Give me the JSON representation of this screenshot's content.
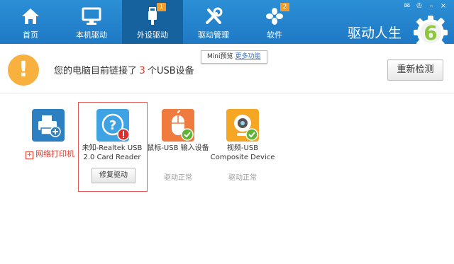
{
  "window": {
    "buttons": [
      "✉",
      "♔",
      "–",
      "×"
    ]
  },
  "tabs": [
    {
      "label": "首页",
      "icon": "home-icon"
    },
    {
      "label": "本机驱动",
      "icon": "monitor-icon"
    },
    {
      "label": "外设驱动",
      "icon": "usb-icon",
      "badge": "1",
      "active": true
    },
    {
      "label": "驱动管理",
      "icon": "tools-icon"
    },
    {
      "label": "软件",
      "icon": "apps-icon",
      "badge": "2"
    }
  ],
  "brand": {
    "name": "驱动人生",
    "logo_text": "6"
  },
  "info": {
    "prefix": "您的电脑目前链接了",
    "count": "3",
    "suffix": "个USB设备",
    "tooltip_text": "Mini预览",
    "tooltip_link": "更多功能",
    "recheck_label": "重新检测"
  },
  "devices": [
    {
      "icon": "printer-icon",
      "add_label": "网络打印机"
    },
    {
      "icon": "card-reader-icon",
      "name_line1": "未知-Realtek USB",
      "name_line2": "2.0 Card Reader",
      "action": "修复驱动"
    },
    {
      "icon": "mouse-icon",
      "name_line1": "鼠标-USB 输入设备",
      "status": "驱动正常"
    },
    {
      "icon": "webcam-icon",
      "name_line1": "视频-USB",
      "name_line2": "Composite Device",
      "status": "驱动正常"
    }
  ],
  "colors": {
    "topbar": "#1f79c4",
    "active_tab": "#16629f",
    "warning": "#f8b03f",
    "highlight": "#e33b2e"
  }
}
